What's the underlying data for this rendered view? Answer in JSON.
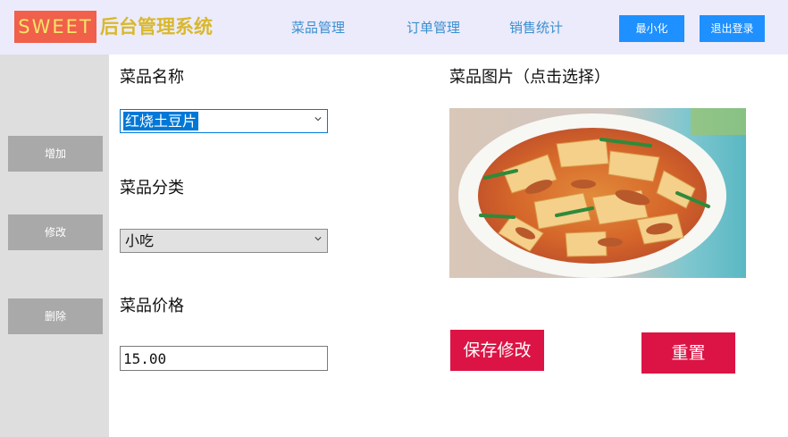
{
  "header": {
    "logo_text": "SWEET",
    "title": "后台管理系统",
    "nav": [
      "菜品管理",
      "订单管理",
      "销售统计"
    ],
    "minimize_label": "最小化",
    "logout_label": "退出登录"
  },
  "sidebar": {
    "add_label": "增加",
    "edit_label": "修改",
    "delete_label": "删除"
  },
  "form": {
    "name_label": "菜品名称",
    "name_value": "红烧土豆片",
    "category_label": "菜品分类",
    "category_value": "小吃",
    "price_label": "菜品价格",
    "price_value": "15.00",
    "image_label": "菜品图片（点击选择）",
    "save_label": "保存修改",
    "reset_label": "重置"
  },
  "colors": {
    "header_bg": "#ecebfb",
    "accent_blue": "#1e90ff",
    "action_red": "#dc1445",
    "sidebar_bg": "#dedede",
    "sidebar_button": "#a9a9a9",
    "selection_blue": "#0078d7"
  }
}
